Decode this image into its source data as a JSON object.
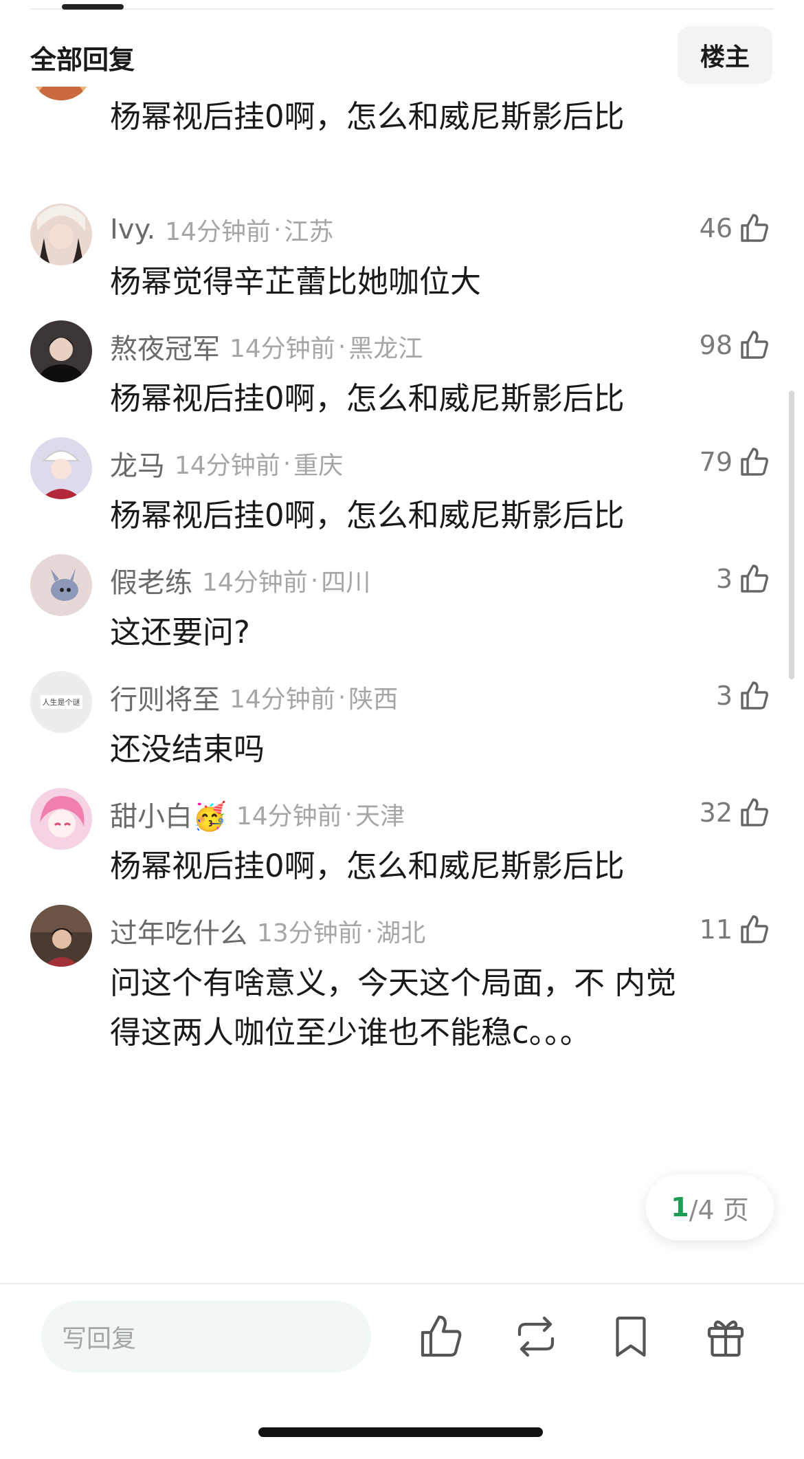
{
  "header": {
    "title": "全部回复",
    "op_label": "楼主"
  },
  "comments": [
    {
      "user": "",
      "time": "",
      "location": "",
      "likes": "",
      "text": "杨幂视后挂0啊，怎么和威尼斯影后比",
      "avatar_color": "#e9b77c"
    },
    {
      "user": "Ivy.",
      "time": "14分钟前",
      "location": "江苏",
      "likes": "46",
      "text": "杨幂觉得辛芷蕾比她咖位大",
      "avatar_color": "#ead7d0"
    },
    {
      "user": "熬夜冠军",
      "time": "14分钟前",
      "location": "黑龙江",
      "likes": "98",
      "text": "杨幂视后挂0啊，怎么和威尼斯影后比",
      "avatar_color": "#3b3536"
    },
    {
      "user": "龙马",
      "time": "14分钟前",
      "location": "重庆",
      "likes": "79",
      "text": "杨幂视后挂0啊，怎么和威尼斯影后比",
      "avatar_color": "#dfd9ec"
    },
    {
      "user": "假老练",
      "time": "14分钟前",
      "location": "四川",
      "likes": "3",
      "text": "这还要问?",
      "avatar_color": "#e7d8d8"
    },
    {
      "user": "行则将至",
      "time": "14分钟前",
      "location": "陕西",
      "likes": "3",
      "text": "还没结束吗",
      "avatar_color": "#ededed",
      "avatar_text": "人生是个谜"
    },
    {
      "user": "甜小白🥳",
      "time": "14分钟前",
      "location": "天津",
      "likes": "32",
      "text": "杨幂视后挂0啊，怎么和威尼斯影后比",
      "avatar_color": "#f6d3e4"
    },
    {
      "user": "过年吃什么",
      "time": "13分钟前",
      "location": "湖北",
      "likes": "11",
      "text": "问这个有啥意义，今天这个局面，不 内觉得这两人咖位至少谁也不能稳c。。。",
      "avatar_color": "#4a3a32"
    }
  ],
  "pager": {
    "current": "1",
    "rest": "/4 页"
  },
  "bottom_bar": {
    "reply_placeholder": "写回复",
    "icons": [
      "thumbs-up-icon",
      "repost-icon",
      "bookmark-icon",
      "gift-icon"
    ]
  },
  "colors": {
    "accent": "#1f9d55",
    "meta": "#a6a6a6",
    "username": "#6a6a6a"
  }
}
